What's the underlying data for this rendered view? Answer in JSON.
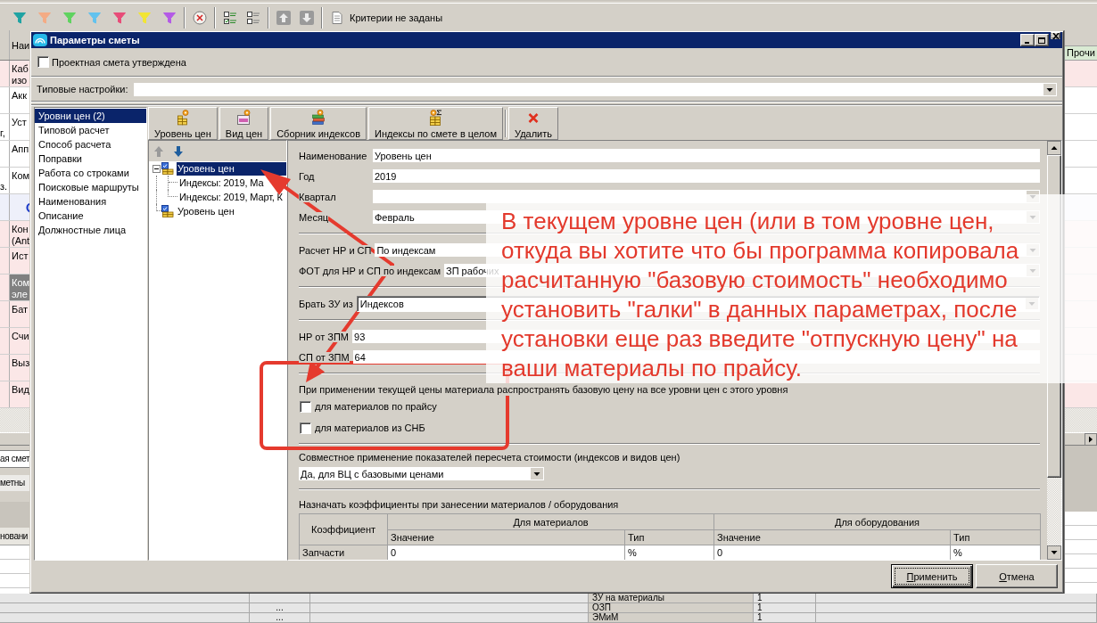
{
  "toolbar": {
    "filters": [
      {
        "color": "#1fa3a3"
      },
      {
        "color": "#f4ab84"
      },
      {
        "color": "#5fd35f"
      },
      {
        "color": "#62c2ee"
      },
      {
        "color": "#e84c78"
      },
      {
        "color": "#f2e534"
      },
      {
        "color": "#b45ae6"
      }
    ],
    "criteria": "Критерии не заданы"
  },
  "table": {
    "headers": [
      "Наи",
      "Прочи"
    ],
    "rows": [
      {
        "kind": "marked",
        "text": "Каб изо",
        "selected": false
      },
      {
        "kind": "plain",
        "text": "Акк",
        "selected": false
      },
      {
        "kind": "plain",
        "text": "Уст",
        "column_1": "г,",
        "selected": false
      },
      {
        "kind": "plain",
        "text": "Апп",
        "selected": false
      },
      {
        "kind": "plain",
        "text": "Ком",
        "column_1": "з.",
        "selected": false
      },
      {
        "kind": "group",
        "selected": false
      },
      {
        "kind": "marked",
        "text": "Кон (Ant",
        "selected": false
      },
      {
        "kind": "marked",
        "text": "Ист",
        "selected": false
      },
      {
        "kind": "marked",
        "text": "Ком эле",
        "selected": true
      },
      {
        "kind": "marked",
        "text": "Бат",
        "selected": false
      },
      {
        "kind": "marked",
        "text": "Счи",
        "selected": false
      },
      {
        "kind": "marked",
        "text": "Выз",
        "selected": false
      },
      {
        "kind": "marked",
        "text": "Вид",
        "selected": false
      }
    ]
  },
  "lower_panel": {
    "tab": "ая смет",
    "row": "метны",
    "column_header": "новани"
  },
  "bottom_table": {
    "rows": [
      {
        "name": "ЗУ на материалы",
        "value": "1"
      },
      {
        "marker": "...",
        "name": "ОЗП",
        "value": "1"
      },
      {
        "marker": "...",
        "name": "ЭМиМ",
        "value": "1"
      }
    ]
  },
  "dialog": {
    "title": "Параметры сметы",
    "approved": {
      "label": "Проектная смета утверждена",
      "checked": false
    },
    "preset": {
      "label": "Типовые настройки:"
    },
    "sections": [
      {
        "label": "Уровни цен (2)",
        "selected": true
      },
      {
        "label": "Типовой расчет",
        "selected": false
      },
      {
        "label": "Способ расчета",
        "selected": false
      },
      {
        "label": "Поправки",
        "selected": false
      },
      {
        "label": "Работа со строками",
        "selected": false
      },
      {
        "label": "Поисковые маршруты",
        "selected": false
      },
      {
        "label": "Наименования",
        "selected": false
      },
      {
        "label": "Описание",
        "selected": false
      },
      {
        "label": "Должностные лица",
        "selected": false
      }
    ],
    "toolbar": [
      {
        "kind": "level",
        "label": "Уровень цен"
      },
      {
        "kind": "price-type",
        "label": "Вид цен"
      },
      {
        "kind": "index-book",
        "label": "Сборник индексов"
      },
      {
        "kind": "index-total",
        "label": "Индексы по смете в целом"
      },
      {
        "kind": "delete",
        "label": "Удалить"
      }
    ],
    "tree": [
      {
        "label": "Уровень цен",
        "selected": true,
        "expanded": true,
        "children": [
          {
            "label": "Индексы: 2019, Ма",
            "selected": false
          },
          {
            "label": "Индексы: 2019, Март, К",
            "selected": false
          }
        ]
      },
      {
        "label": "Уровень цен",
        "selected": false
      }
    ],
    "form": [
      {
        "kind": "aligned",
        "rows": [
          {
            "kind": "text",
            "label": "Наименование",
            "value": "Уровень цен"
          },
          {
            "kind": "text",
            "label": "Год",
            "value": "2019"
          },
          {
            "kind": "combo",
            "label": "Квартал"
          },
          {
            "kind": "combo",
            "label": "Месяц",
            "value": "Февраль"
          }
        ]
      },
      {
        "kind": "fields",
        "rows": [
          {
            "kind": "combo",
            "label": "Расчет НР и СП",
            "value": "По индексам"
          },
          {
            "kind": "combo",
            "label": "ФОТ для НР и СП по индексам",
            "value": "ЗП рабочих"
          }
        ]
      },
      {
        "kind": "fields",
        "rows": [
          {
            "kind": "framed",
            "label": "Брать ЗУ из",
            "value": "Индексов"
          }
        ]
      },
      {
        "kind": "fields",
        "rows": [
          {
            "kind": "text",
            "label": "НР от ЗПМ",
            "value": "93"
          },
          {
            "kind": "text",
            "label": "СП от ЗПМ",
            "value": "64"
          }
        ]
      },
      {
        "kind": "checks",
        "caption": "При применении текущей цены материала распространять базовую цену на все уровни цен с этого уровня",
        "checkboxes": [
          {
            "label": "для материалов по прайсу",
            "checked": false
          },
          {
            "label": "для материалов из СНБ",
            "checked": false
          }
        ]
      },
      {
        "kind": "choice",
        "caption": "Совместное применение показателей пересчета стоимости (индексов и видов цен)",
        "value": "Да, для ВЦ с базовыми ценами"
      },
      {
        "kind": "table",
        "caption": "Назначать коэффициенты при занесении материалов / оборудования",
        "row_header": "Коэффициент",
        "groups": [
          "Для материалов",
          "Для оборудования"
        ],
        "subcolumns": [
          "Значение",
          "Тип",
          "Значение",
          "Тип"
        ],
        "rows": [
          [
            "Запчасти",
            "0",
            "%",
            "0",
            "%"
          ]
        ]
      }
    ],
    "buttons": [
      {
        "label": "Применить",
        "default": true
      },
      {
        "label": "Отмена",
        "default": false
      }
    ]
  },
  "note": {
    "lines": [
      "В текущем уровне цен (или в том уровне цен,",
      "откуда вы хотите что бы программа копировала",
      "расчитанную \"базовую стоимость\" необходимо",
      "установить \"галки\" в данных параметрах, после",
      "установки еще раз введите \"отпускную цену\" на",
      "ваши материалы по прайсу."
    ]
  }
}
